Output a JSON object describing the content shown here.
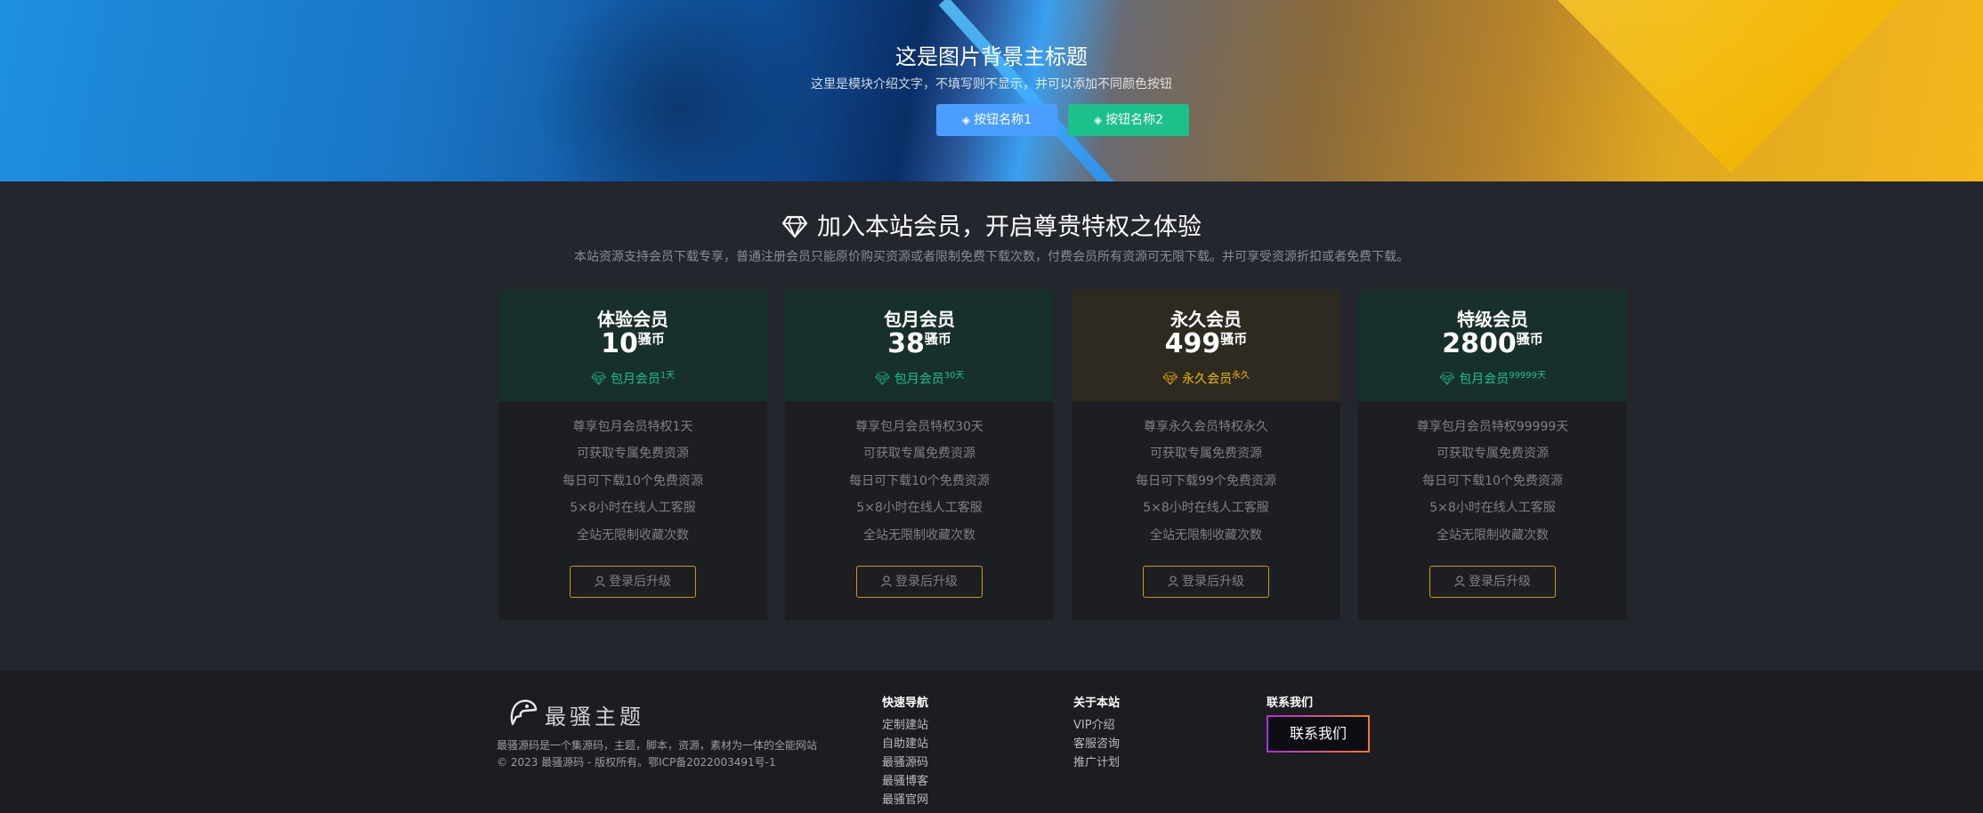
{
  "hero": {
    "title": "这是图片背景主标题",
    "subtitle": "这里是模块介绍文字，不填写则不显示，并可以添加不同颜色按钮",
    "buttons": [
      {
        "label": "按钮名称1",
        "color": "#4a9eff"
      },
      {
        "label": "按钮名称2",
        "color": "#1cc08a"
      }
    ]
  },
  "vip": {
    "title": "加入本站会员，开启尊贵特权之体验",
    "subtitle": "本站资源支持会员下载专享，普通注册会员只能原价购买资源或者限制免费下载次数，付费会员所有资源可无限下载。并可享受资源折扣或者免费下载。",
    "currency": "骚币",
    "button_label": "登录后升级",
    "cards": [
      {
        "name": "体验会员",
        "price": "10",
        "tag": "包月会员",
        "tag_sup": "1天",
        "theme": "green",
        "features": [
          "尊享包月会员特权1天",
          "可获取专属免费资源",
          "每日可下载10个免费资源",
          "5×8小时在线人工客服",
          "全站无限制收藏次数"
        ]
      },
      {
        "name": "包月会员",
        "price": "38",
        "tag": "包月会员",
        "tag_sup": "30天",
        "theme": "green",
        "features": [
          "尊享包月会员特权30天",
          "可获取专属免费资源",
          "每日可下载10个免费资源",
          "5×8小时在线人工客服",
          "全站无限制收藏次数"
        ]
      },
      {
        "name": "永久会员",
        "price": "499",
        "tag": "永久会员",
        "tag_sup": "永久",
        "theme": "gold",
        "features": [
          "尊享永久会员特权永久",
          "可获取专属免费资源",
          "每日可下载99个免费资源",
          "5×8小时在线人工客服",
          "全站无限制收藏次数"
        ]
      },
      {
        "name": "特级会员",
        "price": "2800",
        "tag": "包月会员",
        "tag_sup": "99999天",
        "theme": "green",
        "features": [
          "尊享包月会员特权99999天",
          "可获取专属免费资源",
          "每日可下载10个免费资源",
          "5×8小时在线人工客服",
          "全站无限制收藏次数"
        ]
      }
    ]
  },
  "footer": {
    "logo_text": "最骚主题",
    "description": "最骚源码是一个集源码，主题，脚本，资源，素材为一体的全能网站",
    "copyright": "© 2023 最骚源码 - 版权所有。鄂ICP备2022003491号-1",
    "columns": [
      {
        "title": "快速导航",
        "links": [
          "定制建站",
          "自助建站",
          "最骚源码",
          "最骚博客",
          "最骚官网"
        ]
      },
      {
        "title": "关于本站",
        "links": [
          "VIP介绍",
          "客服咨询",
          "推广计划"
        ]
      },
      {
        "title": "联系我们",
        "links": []
      }
    ],
    "contact_button": "联系我们"
  }
}
